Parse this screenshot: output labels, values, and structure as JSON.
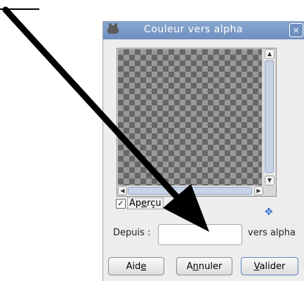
{
  "dialog": {
    "title": "Couleur vers alpha",
    "close_symbol": "×",
    "preview_checkbox": {
      "checked": true,
      "check_symbol": "✓",
      "label_pre": "Ap",
      "label_mnemonic": "e",
      "label_post": "rçu"
    },
    "depuis_label": "Depuis :",
    "color_value": "",
    "vers_alpha_label": "vers alpha",
    "buttons": {
      "help_pre": "Aid",
      "help_mnemonic": "e",
      "help_post": "",
      "cancel_pre": "A",
      "cancel_mnemonic": "n",
      "cancel_post": "nuler",
      "ok_pre": "",
      "ok_mnemonic": "V",
      "ok_post": "alider"
    }
  },
  "icons": {
    "app": "gimp-icon",
    "nav": "navigate-icon",
    "nav_symbol": "✥",
    "scroll_up_symbol": "▲",
    "scroll_down_symbol": "▼",
    "scroll_left_symbol": "◀",
    "scroll_right_symbol": "▶"
  },
  "colors": {
    "titlebar": "#7a9ac7",
    "checker_dark": "#666666",
    "checker_light": "#999999",
    "arrow": "#000000"
  }
}
